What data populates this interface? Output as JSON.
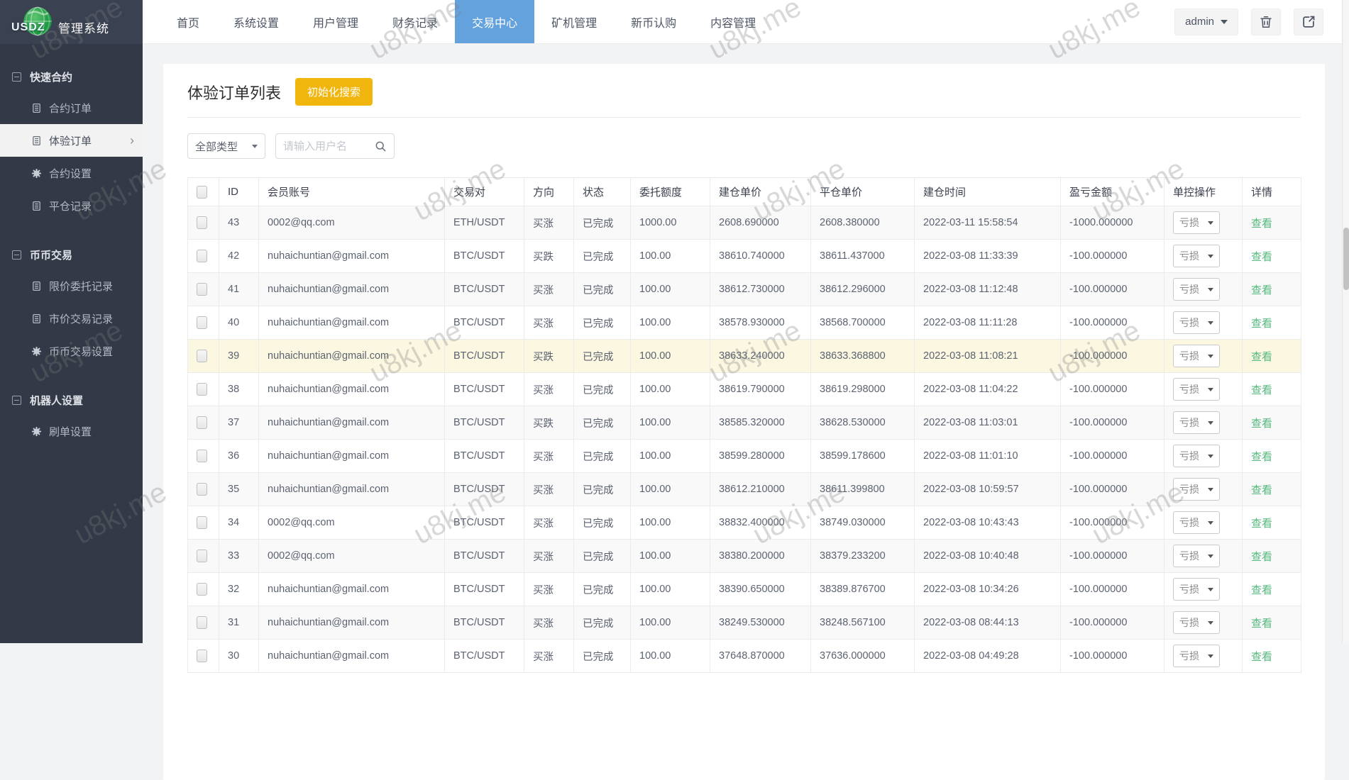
{
  "app": {
    "logo_text": "USDZ",
    "title": "管理系统"
  },
  "topnav": {
    "items": [
      {
        "label": "首页"
      },
      {
        "label": "系统设置"
      },
      {
        "label": "用户管理"
      },
      {
        "label": "财务记录"
      },
      {
        "label": "交易中心"
      },
      {
        "label": "矿机管理"
      },
      {
        "label": "新币认购"
      },
      {
        "label": "内容管理"
      }
    ],
    "active": "交易中心",
    "user_menu_label": "admin"
  },
  "sidebar": {
    "groups": [
      {
        "label": "快速合约",
        "items": [
          {
            "label": "合约订单",
            "icon": "list"
          },
          {
            "label": "体验订单",
            "icon": "list",
            "active": true
          },
          {
            "label": "合约设置",
            "icon": "gear"
          },
          {
            "label": "平仓记录",
            "icon": "list"
          }
        ]
      },
      {
        "label": "币币交易",
        "items": [
          {
            "label": "限价委托记录",
            "icon": "list"
          },
          {
            "label": "市价交易记录",
            "icon": "list"
          },
          {
            "label": "币币交易设置",
            "icon": "gear"
          }
        ]
      },
      {
        "label": "机器人设置",
        "items": [
          {
            "label": "刷单设置",
            "icon": "gear"
          }
        ]
      }
    ]
  },
  "page": {
    "title": "体验订单列表",
    "init_button_label": "初始化搜索"
  },
  "filters": {
    "type_select_value": "全部类型",
    "username_placeholder": "请输入用户名"
  },
  "table": {
    "headers": [
      "ID",
      "会员账号",
      "交易对",
      "方向",
      "状态",
      "委托额度",
      "建仓单价",
      "平仓单价",
      "建仓时间",
      "盈亏金额",
      "单控操作",
      "详情"
    ],
    "control_label": "亏损",
    "detail_label": "查看",
    "rows": [
      {
        "id": "43",
        "account": "0002@qq.com",
        "pair": "ETH/USDT",
        "direction": "买涨",
        "dir": "up",
        "status": "已完成",
        "amount": "1000.00",
        "open_price": "2608.690000",
        "close_price": "2608.380000",
        "open_time": "2022-03-11 15:58:54",
        "profit": "-1000.000000",
        "highlight": false
      },
      {
        "id": "42",
        "account": "nuhaichuntian@gmail.com",
        "pair": "BTC/USDT",
        "direction": "买跌",
        "dir": "down",
        "status": "已完成",
        "amount": "100.00",
        "open_price": "38610.740000",
        "close_price": "38611.437000",
        "open_time": "2022-03-08 11:33:39",
        "profit": "-100.000000",
        "highlight": false
      },
      {
        "id": "41",
        "account": "nuhaichuntian@gmail.com",
        "pair": "BTC/USDT",
        "direction": "买涨",
        "dir": "up",
        "status": "已完成",
        "amount": "100.00",
        "open_price": "38612.730000",
        "close_price": "38612.296000",
        "open_time": "2022-03-08 11:12:48",
        "profit": "-100.000000",
        "highlight": false
      },
      {
        "id": "40",
        "account": "nuhaichuntian@gmail.com",
        "pair": "BTC/USDT",
        "direction": "买涨",
        "dir": "up",
        "status": "已完成",
        "amount": "100.00",
        "open_price": "38578.930000",
        "close_price": "38568.700000",
        "open_time": "2022-03-08 11:11:28",
        "profit": "-100.000000",
        "highlight": false
      },
      {
        "id": "39",
        "account": "nuhaichuntian@gmail.com",
        "pair": "BTC/USDT",
        "direction": "买跌",
        "dir": "down",
        "status": "已完成",
        "amount": "100.00",
        "open_price": "38633.240000",
        "close_price": "38633.368800",
        "open_time": "2022-03-08 11:08:21",
        "profit": "-100.000000",
        "highlight": true
      },
      {
        "id": "38",
        "account": "nuhaichuntian@gmail.com",
        "pair": "BTC/USDT",
        "direction": "买涨",
        "dir": "up",
        "status": "已完成",
        "amount": "100.00",
        "open_price": "38619.790000",
        "close_price": "38619.298000",
        "open_time": "2022-03-08 11:04:22",
        "profit": "-100.000000",
        "highlight": false
      },
      {
        "id": "37",
        "account": "nuhaichuntian@gmail.com",
        "pair": "BTC/USDT",
        "direction": "买跌",
        "dir": "down",
        "status": "已完成",
        "amount": "100.00",
        "open_price": "38585.320000",
        "close_price": "38628.530000",
        "open_time": "2022-03-08 11:03:01",
        "profit": "-100.000000",
        "highlight": false
      },
      {
        "id": "36",
        "account": "nuhaichuntian@gmail.com",
        "pair": "BTC/USDT",
        "direction": "买涨",
        "dir": "up",
        "status": "已完成",
        "amount": "100.00",
        "open_price": "38599.280000",
        "close_price": "38599.178600",
        "open_time": "2022-03-08 11:01:10",
        "profit": "-100.000000",
        "highlight": false
      },
      {
        "id": "35",
        "account": "nuhaichuntian@gmail.com",
        "pair": "BTC/USDT",
        "direction": "买涨",
        "dir": "up",
        "status": "已完成",
        "amount": "100.00",
        "open_price": "38612.210000",
        "close_price": "38611.399800",
        "open_time": "2022-03-08 10:59:57",
        "profit": "-100.000000",
        "highlight": false
      },
      {
        "id": "34",
        "account": "0002@qq.com",
        "pair": "BTC/USDT",
        "direction": "买涨",
        "dir": "up",
        "status": "已完成",
        "amount": "100.00",
        "open_price": "38832.400000",
        "close_price": "38749.030000",
        "open_time": "2022-03-08 10:43:43",
        "profit": "-100.000000",
        "highlight": false
      },
      {
        "id": "33",
        "account": "0002@qq.com",
        "pair": "BTC/USDT",
        "direction": "买涨",
        "dir": "up",
        "status": "已完成",
        "amount": "100.00",
        "open_price": "38380.200000",
        "close_price": "38379.233200",
        "open_time": "2022-03-08 10:40:48",
        "profit": "-100.000000",
        "highlight": false
      },
      {
        "id": "32",
        "account": "nuhaichuntian@gmail.com",
        "pair": "BTC/USDT",
        "direction": "买涨",
        "dir": "up",
        "status": "已完成",
        "amount": "100.00",
        "open_price": "38390.650000",
        "close_price": "38389.876700",
        "open_time": "2022-03-08 10:34:26",
        "profit": "-100.000000",
        "highlight": false
      },
      {
        "id": "31",
        "account": "nuhaichuntian@gmail.com",
        "pair": "BTC/USDT",
        "direction": "买涨",
        "dir": "up",
        "status": "已完成",
        "amount": "100.00",
        "open_price": "38249.530000",
        "close_price": "38248.567100",
        "open_time": "2022-03-08 08:44:13",
        "profit": "-100.000000",
        "highlight": false
      },
      {
        "id": "30",
        "account": "nuhaichuntian@gmail.com",
        "pair": "BTC/USDT",
        "direction": "买涨",
        "dir": "up",
        "status": "已完成",
        "amount": "100.00",
        "open_price": "37648.870000",
        "close_price": "37636.000000",
        "open_time": "2022-03-08 04:49:28",
        "profit": "-100.000000",
        "highlight": false
      }
    ]
  },
  "watermark_text": "u8kj.me",
  "colors": {
    "nav_active_blue": "#64a2dd",
    "button_yellow": "#f0b60d",
    "success_green": "#53b97c",
    "direction_red": "#e85353",
    "price_red": "#e06b6b",
    "row_highlight": "#fcf7e1",
    "sidebar_bg": "#333946",
    "logo_bg": "#3a4150"
  }
}
